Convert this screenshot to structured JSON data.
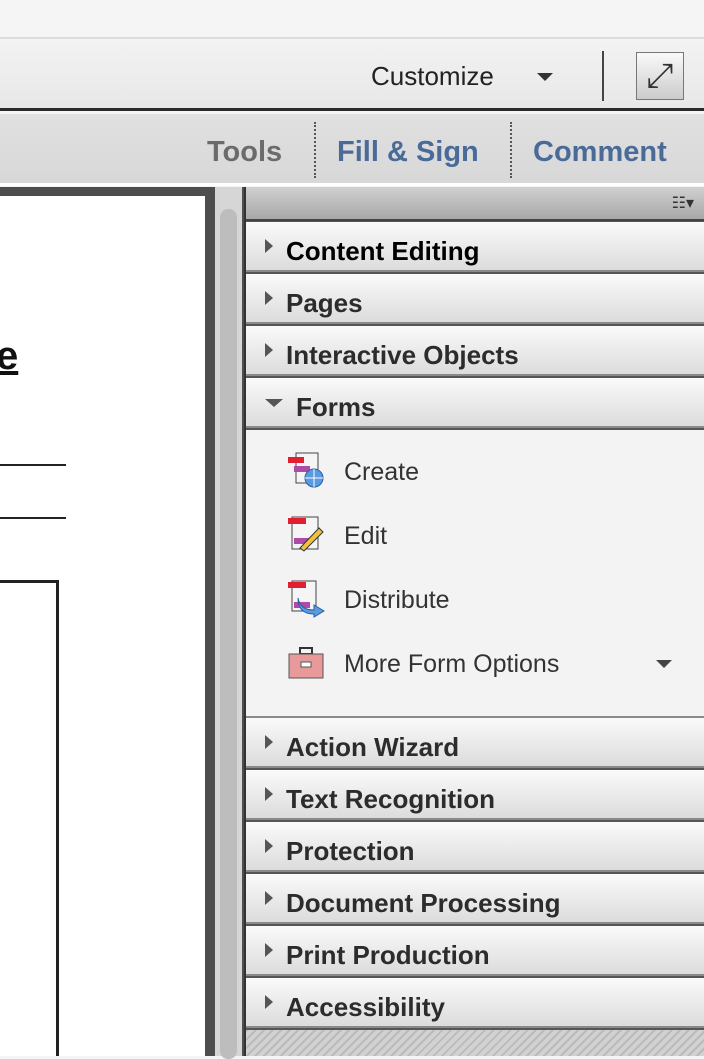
{
  "toolbar": {
    "customize_label": "Customize",
    "expand_icon": "expand-arrows-icon"
  },
  "tabs": [
    {
      "label": "Tools",
      "color": "#6b6b6b"
    },
    {
      "label": "Fill & Sign",
      "color": "#4a6b98"
    },
    {
      "label": "Comment",
      "color": "#4a6b98"
    }
  ],
  "document": {
    "heading_fragment": "e"
  },
  "panel": {
    "sections_before": [
      "Content Editing",
      "Pages",
      "Interactive Objects"
    ],
    "forms": {
      "label": "Forms",
      "items": [
        "Create",
        "Edit",
        "Distribute",
        "More Form Options"
      ]
    },
    "sections_after": [
      "Action Wizard",
      "Text Recognition",
      "Protection",
      "Document Processing",
      "Print Production",
      "Accessibility"
    ]
  }
}
